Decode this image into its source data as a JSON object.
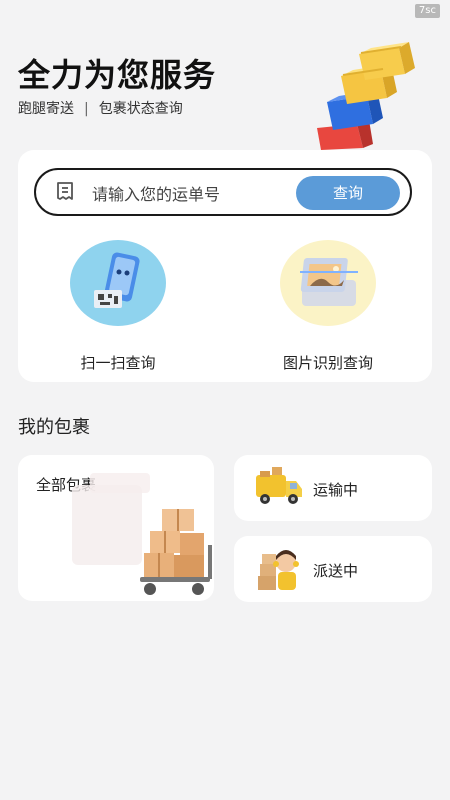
{
  "status_badge": "7sc",
  "hero": {
    "title": "全力为您服务",
    "tag1": "跑腿寄送",
    "separator": "|",
    "tag2": "包裹状态查询",
    "art_icon": "stacked-boxes-icon"
  },
  "search": {
    "placeholder": "请输入您的运单号",
    "button": "查询",
    "icon": "waybill-icon"
  },
  "actions": [
    {
      "label": "扫一扫查询",
      "icon": "phone-scan-icon"
    },
    {
      "label": "图片识别查询",
      "icon": "image-recognition-icon"
    }
  ],
  "my_packages": {
    "title": "我的包裹",
    "all": {
      "label": "全部包裹",
      "icon": "parcel-cart-icon"
    },
    "transit": {
      "label": "运输中",
      "icon": "delivery-truck-icon"
    },
    "delivering": {
      "label": "派送中",
      "icon": "courier-icon"
    }
  },
  "colors": {
    "accent": "#5b9bd8",
    "background": "#f3f3f4",
    "scan_circle": "#8fd3ee",
    "image_circle": "#fbf3c6"
  }
}
